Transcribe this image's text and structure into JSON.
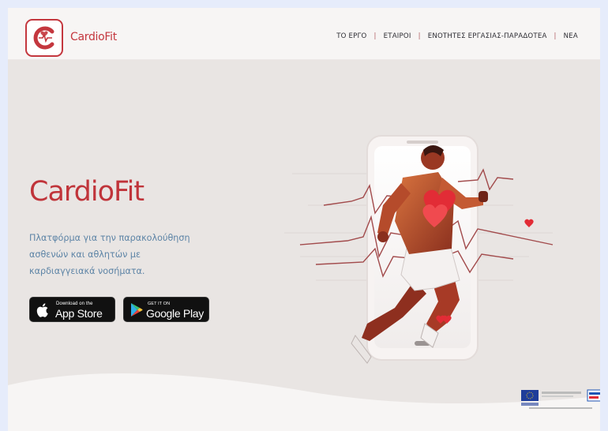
{
  "brand": {
    "name": "CardioFit",
    "accent_color": "#c4373e"
  },
  "nav": {
    "items": [
      {
        "label": "ΤΟ ΕΡΓΟ"
      },
      {
        "label": "ΕΤΑΙΡΟΙ"
      },
      {
        "label": "ΕΝΟΤΗΤΕΣ ΕΡΓΑΣΙΑΣ-ΠΑΡΑΔΟΤΕΑ"
      },
      {
        "label": "ΝΕΑ"
      }
    ]
  },
  "hero": {
    "title": "CardioFit",
    "subtitle_lines": [
      "Πλατφόρμα για την παρακολούθηση",
      "ασθενών και αθλητών με",
      "καρδιαγγειακά νοσήματα."
    ]
  },
  "stores": {
    "appstore": {
      "small": "Download on the",
      "big": "App Store",
      "icon": "apple-icon"
    },
    "googleplay": {
      "small": "GET IT ON",
      "big": "Google Play",
      "icon": "google-play-icon"
    }
  },
  "colors": {
    "title_red": "#c0343a",
    "subtitle_blue": "#5d84a6",
    "background": "#e9e5e3"
  }
}
